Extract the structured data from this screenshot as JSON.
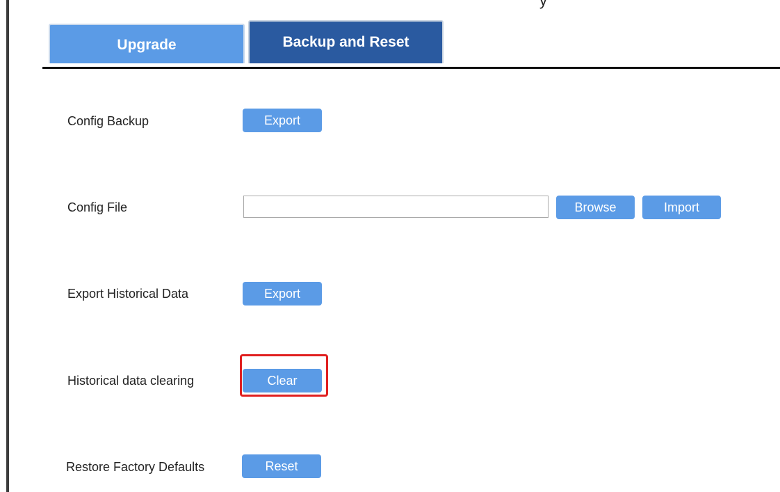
{
  "tabs": [
    {
      "label": "Upgrade",
      "active": false
    },
    {
      "label": "Backup and Reset",
      "active": true
    }
  ],
  "top_glyph": "y",
  "rows": {
    "config_backup": {
      "label": "Config Backup",
      "button": "Export"
    },
    "config_file": {
      "label": "Config File",
      "input_value": "",
      "browse": "Browse",
      "import": "Import"
    },
    "export_history": {
      "label": "Export Historical Data",
      "button": "Export"
    },
    "history_clear": {
      "label": "Historical data clearing",
      "button": "Clear"
    },
    "restore_defaults": {
      "label": "Restore Factory Defaults",
      "button": "Reset"
    }
  },
  "colors": {
    "button": "#5b9be6",
    "tab_active": "#2a5aa0",
    "tab_inactive": "#5b9be6",
    "highlight": "#e02020"
  }
}
